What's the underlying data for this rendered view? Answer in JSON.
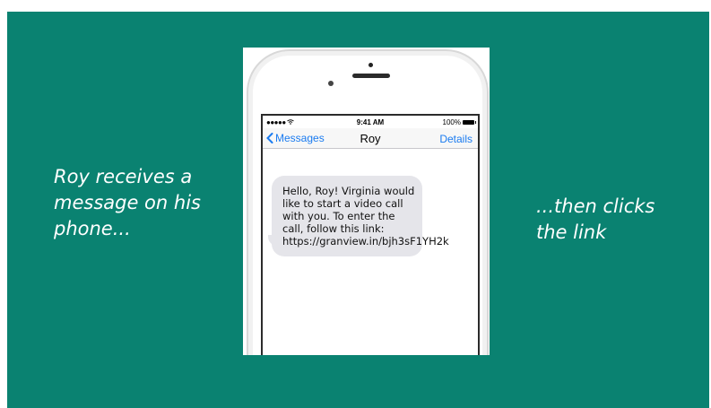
{
  "captions": {
    "left": "Roy receives a message on his phone...",
    "right": "...then clicks the link"
  },
  "phone": {
    "status": {
      "signal": "●●●●● ",
      "wifi_icon": "wifi-icon",
      "time": "9:41 AM",
      "battery_pct": "100%"
    },
    "nav": {
      "back_label": "Messages",
      "title": "Roy",
      "details_label": "Details"
    },
    "message": {
      "text": "Hello, Roy! Virginia would like to start a video call with you. To enter the call, follow this link: https://granview.in/bjh3sF1YH2k"
    }
  },
  "colors": {
    "background": "#0a8271",
    "ios_blue": "#1a7bf0",
    "bubble": "#e5e5ea"
  }
}
